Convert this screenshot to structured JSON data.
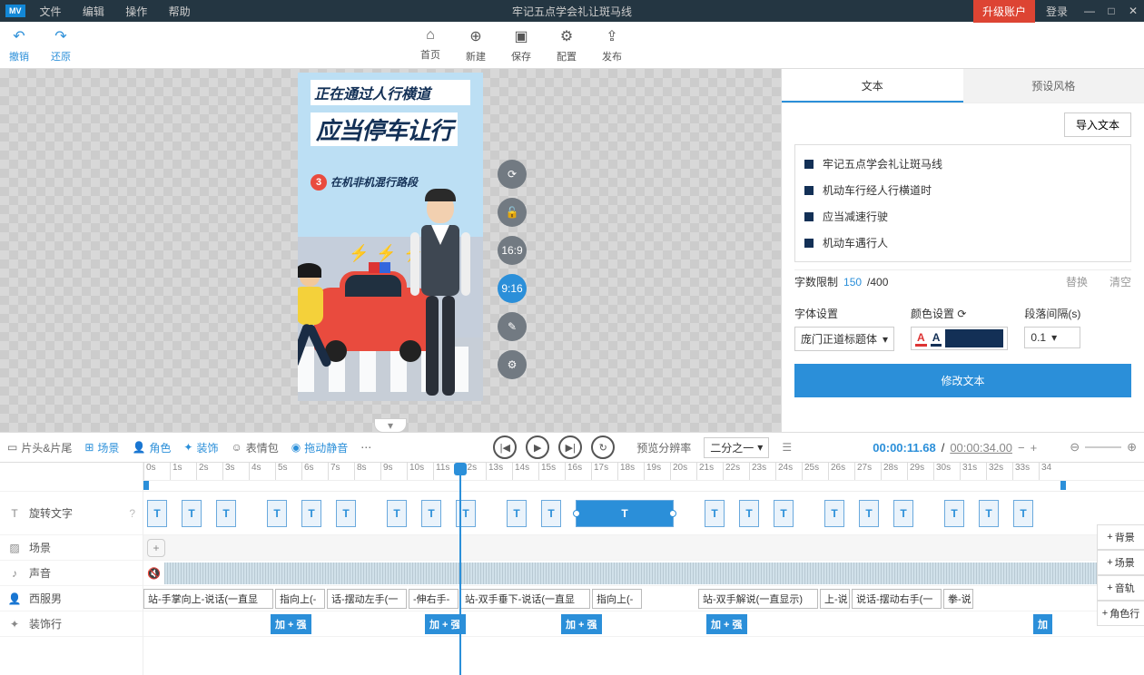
{
  "titlebar": {
    "logo": "MV",
    "menus": [
      "文件",
      "编辑",
      "操作",
      "帮助"
    ],
    "title": "牢记五点学会礼让斑马线",
    "upgrade": "升级账户",
    "login": "登录"
  },
  "toolbar": {
    "undo": "撤销",
    "redo": "还原",
    "home": "首页",
    "new": "新建",
    "save": "保存",
    "config": "配置",
    "publish": "发布"
  },
  "canvas": {
    "line1": "正在通过人行横道",
    "line2": "应当停车让行",
    "badge": "3",
    "line3": "在机非机混行路段",
    "aspect1": "16:9",
    "aspect2": "9:16"
  },
  "panel": {
    "tab_text": "文本",
    "tab_style": "预设风格",
    "import": "导入文本",
    "items": [
      "牢记五点学会礼让斑马线",
      "机动车行经人行横道时",
      "应当减速行驶",
      "机动车遇行人"
    ],
    "limit_label": "字数限制",
    "limit_cur": "150",
    "limit_sep": " /400",
    "replace": "替换",
    "clear": "清空",
    "font_label": "字体设置",
    "font_value": "庞门正道标题体",
    "color_label": "颜色设置",
    "gap_label": "段落间隔(s)",
    "gap_value": "0.1",
    "modify": "修改文本"
  },
  "tlbar": {
    "head_tail": "片头&片尾",
    "scene": "场景",
    "role": "角色",
    "decor": "装饰",
    "emoji": "表情包",
    "drag_mute": "拖动静音",
    "preview_label": "预览分辨率",
    "preview_value": "二分之一",
    "time_cur": "00:00:11.68",
    "time_sep": " / ",
    "time_total": "00:00:34.00"
  },
  "tracks": {
    "rotate_text": "旋转文字",
    "scene": "场景",
    "audio": "声音",
    "man": "西服男",
    "decor": "装饰行",
    "add_bg": "背景",
    "add_scene": "场景",
    "add_audio": "音轨",
    "add_role": "角色行",
    "clips_man": [
      "站-手掌向上-说话(一直显",
      "指向上(-",
      "话-摆动左手(一",
      "-伸右手-",
      "站-双手垂下-说话(一直显",
      "指向上(-",
      "站-双手解说(一直显示)",
      "上-说",
      "说话-摆动右手(一",
      "拳-说"
    ],
    "clips_decor": [
      "加 + 强",
      "加 + 强",
      "加 + 强",
      "加 + 强",
      "加"
    ]
  },
  "ruler": [
    "0s",
    "1s",
    "2s",
    "3s",
    "4s",
    "5s",
    "6s",
    "7s",
    "8s",
    "9s",
    "10s",
    "11s",
    "12s",
    "13s",
    "14s",
    "15s",
    "16s",
    "17s",
    "18s",
    "19s",
    "20s",
    "21s",
    "22s",
    "23s",
    "24s",
    "25s",
    "26s",
    "27s",
    "28s",
    "29s",
    "30s",
    "31s",
    "32s",
    "33s",
    "34"
  ]
}
